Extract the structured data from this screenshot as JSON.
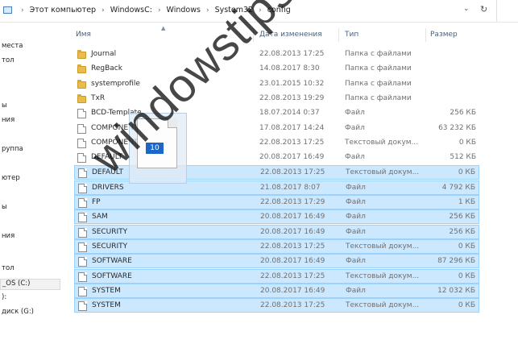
{
  "address_bar": {
    "crumbs": [
      "Этот компьютер",
      "WindowsC:",
      "Windows",
      "System32",
      "config"
    ],
    "separator": "›",
    "dropdown_icon": "chevron-down-icon",
    "refresh_icon": "refresh-icon"
  },
  "nav": {
    "items": [
      {
        "label": "места"
      },
      {
        "label": "тол"
      },
      {
        "label": "ы"
      },
      {
        "label": "ния"
      },
      {
        "label": "руппа"
      },
      {
        "label": "ютер"
      },
      {
        "label": "ы"
      },
      {
        "label": "ния"
      },
      {
        "label": "тол"
      },
      {
        "label": "_OS (C:)",
        "selected": true
      },
      {
        "label": "):"
      },
      {
        "label": "диск (G:)"
      }
    ]
  },
  "columns": {
    "name": "Имя",
    "date": "Дата изменения",
    "type": "Тип",
    "size": "Размер"
  },
  "files": [
    {
      "icon": "folder-icon",
      "name": "Journal",
      "date": "22.08.2013 17:25",
      "type": "Папка с файлами",
      "size": "",
      "selected": false
    },
    {
      "icon": "folder-icon",
      "name": "RegBack",
      "date": "14.08.2017 8:30",
      "type": "Папка с файлами",
      "size": "",
      "selected": false
    },
    {
      "icon": "folder-icon",
      "name": "systemprofile",
      "date": "23.01.2015 10:32",
      "type": "Папка с файлами",
      "size": "",
      "selected": false
    },
    {
      "icon": "folder-icon",
      "name": "TxR",
      "date": "22.08.2013 19:29",
      "type": "Папка с файлами",
      "size": "",
      "selected": false
    },
    {
      "icon": "file-icon",
      "name": "BCD-Template",
      "date": "18.07.2014 0:37",
      "type": "Файл",
      "size": "256 КБ",
      "selected": false
    },
    {
      "icon": "file-icon",
      "name": "COMPONENTS",
      "date": "17.08.2017 14:24",
      "type": "Файл",
      "size": "63 232 КБ",
      "selected": false
    },
    {
      "icon": "file-icon",
      "name": "COMPONENTS",
      "date": "22.08.2013 17:25",
      "type": "Текстовый докум...",
      "size": "0 КБ",
      "selected": false
    },
    {
      "icon": "file-icon",
      "name": "DEFAULT",
      "date": "20.08.2017 16:49",
      "type": "Файл",
      "size": "512 КБ",
      "selected": false
    },
    {
      "icon": "file-icon",
      "name": "DEFAULT",
      "date": "22.08.2013 17:25",
      "type": "Текстовый докум...",
      "size": "0 КБ",
      "selected": true
    },
    {
      "icon": "file-icon",
      "name": "DRIVERS",
      "date": "21.08.2017 8:07",
      "type": "Файл",
      "size": "4 792 КБ",
      "selected": true
    },
    {
      "icon": "file-icon",
      "name": "FP",
      "date": "22.08.2013 17:29",
      "type": "Файл",
      "size": "1 КБ",
      "selected": true
    },
    {
      "icon": "file-icon",
      "name": "SAM",
      "date": "20.08.2017 16:49",
      "type": "Файл",
      "size": "256 КБ",
      "selected": true
    },
    {
      "icon": "file-icon",
      "name": "SECURITY",
      "date": "20.08.2017 16:49",
      "type": "Файл",
      "size": "256 КБ",
      "selected": true
    },
    {
      "icon": "file-icon",
      "name": "SECURITY",
      "date": "22.08.2013 17:25",
      "type": "Текстовый докум...",
      "size": "0 КБ",
      "selected": true
    },
    {
      "icon": "file-icon",
      "name": "SOFTWARE",
      "date": "20.08.2017 16:49",
      "type": "Файл",
      "size": "87 296 КБ",
      "selected": true
    },
    {
      "icon": "file-icon",
      "name": "SOFTWARE",
      "date": "22.08.2013 17:25",
      "type": "Текстовый докум...",
      "size": "0 КБ",
      "selected": true
    },
    {
      "icon": "file-icon",
      "name": "SYSTEM",
      "date": "20.08.2017 16:49",
      "type": "Файл",
      "size": "12 032 КБ",
      "selected": true
    },
    {
      "icon": "file-icon",
      "name": "SYSTEM",
      "date": "22.08.2013 17:25",
      "type": "Текстовый докум...",
      "size": "0 КБ",
      "selected": true
    }
  ],
  "drag_ghost": {
    "count": "10"
  },
  "watermark": "windowstips.ru",
  "colors": {
    "selection_bg": "#cce8ff",
    "selection_border": "#99d1ff",
    "folder": "#e8bd4d",
    "drag_badge": "#1c66c6"
  }
}
